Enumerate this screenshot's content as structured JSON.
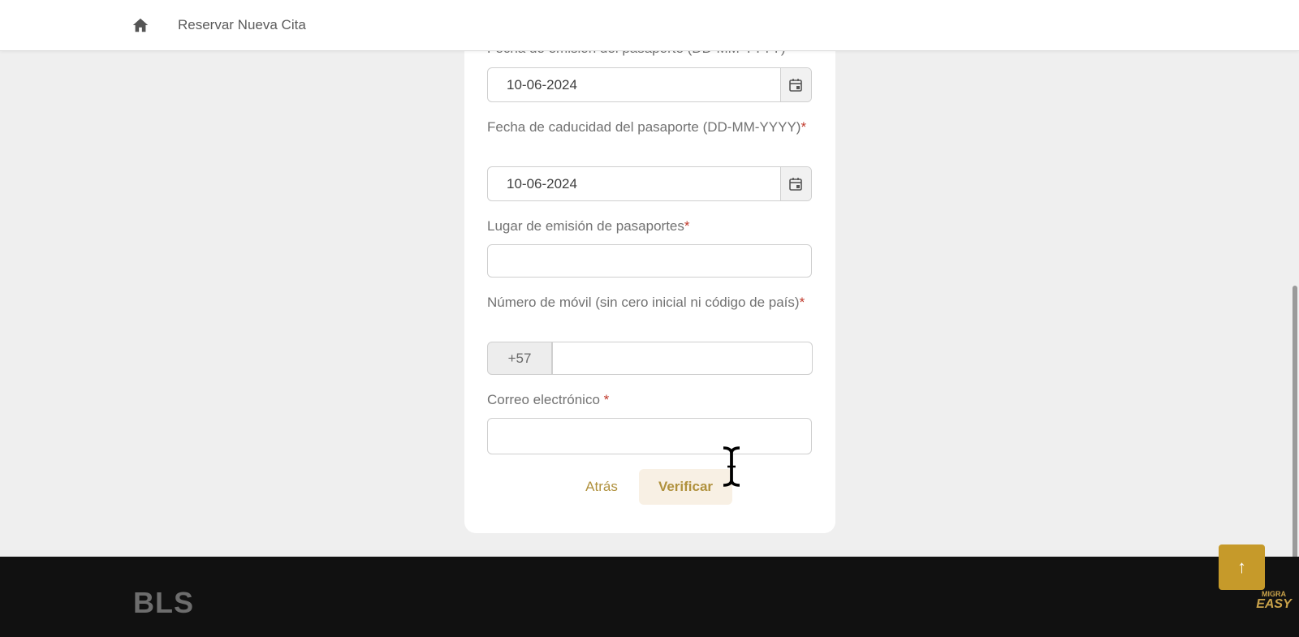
{
  "header": {
    "title": "Reservar Nueva Cita",
    "home_icon": "home-icon"
  },
  "form": {
    "issue_date": {
      "label": "Fecha de emisión del pasaporte (DD-MM-YYYY)",
      "value": "10-06-2024"
    },
    "expiry_date": {
      "label": "Fecha de caducidad del pasaporte (DD-MM-YYYY)",
      "required_mark": "*",
      "value": "10-06-2024"
    },
    "issue_place": {
      "label": "Lugar de emisión de pasaportes",
      "required_mark": "*",
      "value": ""
    },
    "mobile": {
      "label": "Número de móvil (sin cero inicial ni código de país)",
      "required_mark": "*",
      "prefix": "+57",
      "value": ""
    },
    "email": {
      "label": "Correo electrónico ",
      "required_mark": "*",
      "value": ""
    },
    "buttons": {
      "back": "Atrás",
      "verify": "Verificar"
    }
  },
  "footer": {
    "logo_text": "BLS"
  },
  "scroll_top": {
    "icon": "arrow-up-icon",
    "label": "↑"
  },
  "watermark": {
    "top": "MIGRA",
    "bottom": "EASY"
  },
  "colors": {
    "accent": "#c69a2a",
    "button_text": "#b0913d",
    "required": "#c0392b",
    "footer_bg": "#111111"
  }
}
